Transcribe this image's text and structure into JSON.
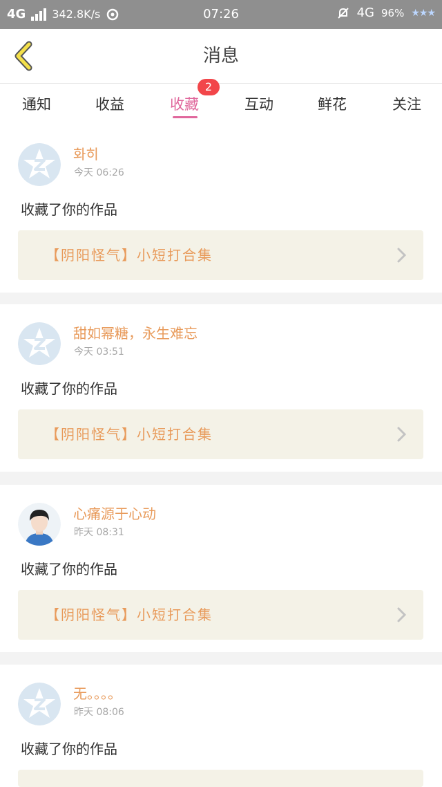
{
  "status_bar": {
    "network_left": "4G",
    "speed": "342.8K/s",
    "time": "07:26",
    "network_right": "4G",
    "battery": "96%"
  },
  "header": {
    "title": "消息",
    "back_icon": "chevron-left-icon"
  },
  "tabs": [
    {
      "label": "通知"
    },
    {
      "label": "收益"
    },
    {
      "label": "收藏",
      "active": true,
      "badge": "2"
    },
    {
      "label": "互动"
    },
    {
      "label": "鲜花"
    },
    {
      "label": "关注"
    }
  ],
  "accent_color": "#e0679c",
  "name_color": "#e89a5a",
  "notifications": [
    {
      "user": "화히",
      "time": "今天 06:26",
      "action": "收藏了你的作品",
      "work": "【阴阳怪气】小短打合集",
      "avatar": "qzone-default-avatar"
    },
    {
      "user": "甜如幂糖，永生难忘",
      "time": "今天 03:51",
      "action": "收藏了你的作品",
      "work": "【阴阳怪气】小短打合集",
      "avatar": "qzone-default-avatar"
    },
    {
      "user": "心痛源于心动",
      "time": "昨天 08:31",
      "action": "收藏了你的作品",
      "work": "【阴阳怪气】小短打合集",
      "avatar": "photo-avatar"
    },
    {
      "user": "无。。。。",
      "time": "昨天 08:06",
      "action": "收藏了你的作品",
      "work": "",
      "avatar": "qzone-default-avatar"
    }
  ]
}
